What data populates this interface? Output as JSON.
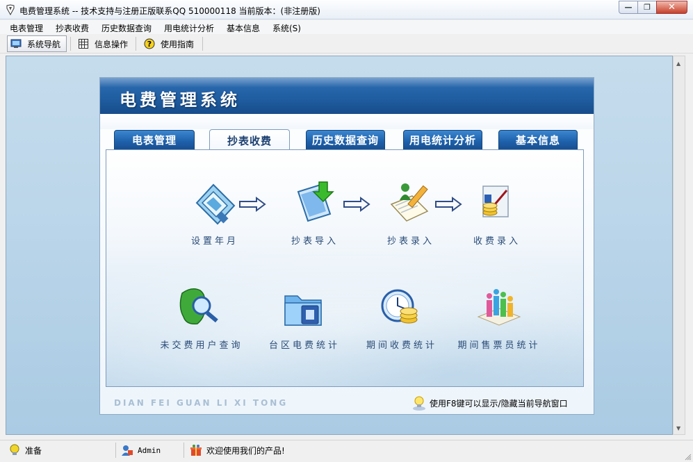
{
  "window": {
    "title": "电费管理系统 -- 技术支持与注册正版联系QQ 510000118    当前版本：(非注册版)"
  },
  "menu": [
    "电表管理",
    "抄表收费",
    "历史数据查询",
    "用电统计分析",
    "基本信息",
    "系统(S)"
  ],
  "toolbar": {
    "nav_label": "系统导航",
    "info_label": "信息操作",
    "guide_label": "使用指南"
  },
  "panel": {
    "title": "电费管理系统",
    "tabs": [
      "电表管理",
      "抄表收费",
      "历史数据查询",
      "用电统计分析",
      "基本信息"
    ],
    "active_tab": "抄表收费",
    "row1": [
      "设置年月",
      "抄表导入",
      "抄表录入",
      "收费录入"
    ],
    "row2": [
      "未交费用户查询",
      "台区电费统计",
      "期间收费统计",
      "期间售票员统计"
    ],
    "footer_text": "DIAN FEI GUAN LI XI TONG",
    "hint": "使用F8键可以显示/隐藏当前导航窗口"
  },
  "status": {
    "ready": "准备",
    "user": "Admin",
    "welcome": "欢迎使用我们的产品!"
  },
  "colors": {
    "header_blue": "#1f5ca0",
    "tab_blue": "#1f62ad",
    "label_blue": "#2a4b77"
  }
}
